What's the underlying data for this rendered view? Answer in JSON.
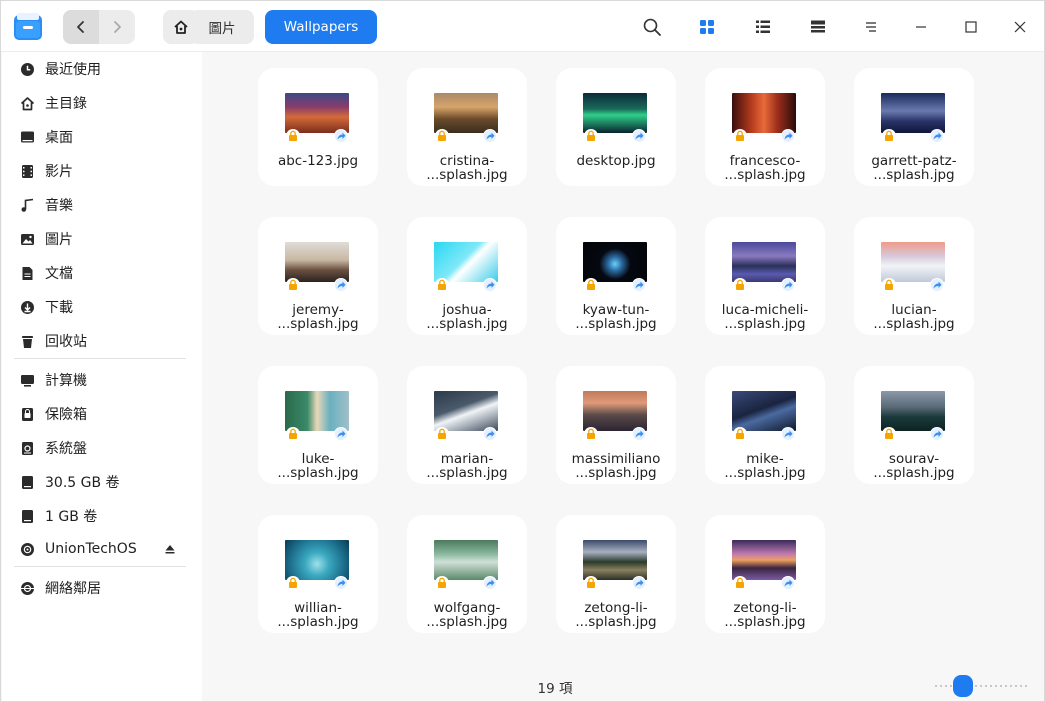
{
  "breadcrumb": {
    "parent": "圖片",
    "current": "Wallpapers"
  },
  "sidebar": {
    "items": [
      {
        "label": "最近使用",
        "icon": "clock-icon"
      },
      {
        "label": "主目錄",
        "icon": "home-icon"
      },
      {
        "label": "桌面",
        "icon": "desktop-icon"
      },
      {
        "label": "影片",
        "icon": "film-icon"
      },
      {
        "label": "音樂",
        "icon": "music-icon"
      },
      {
        "label": "圖片",
        "icon": "picture-icon"
      },
      {
        "label": "文檔",
        "icon": "document-icon"
      },
      {
        "label": "下載",
        "icon": "download-icon"
      },
      {
        "label": "回收站",
        "icon": "trash-icon"
      },
      {
        "label": "計算機",
        "icon": "computer-icon"
      },
      {
        "label": "保險箱",
        "icon": "vault-icon"
      },
      {
        "label": "系統盤",
        "icon": "system-disk-icon"
      },
      {
        "label": "30.5 GB 卷",
        "icon": "disk-icon"
      },
      {
        "label": "1 GB 卷",
        "icon": "disk-icon"
      },
      {
        "label": "UnionTechOS",
        "icon": "disc-icon"
      },
      {
        "label": "網絡鄰居",
        "icon": "network-icon"
      }
    ]
  },
  "files": [
    {
      "line1": "abc-123.jpg",
      "line2": ""
    },
    {
      "line1": "cristina-",
      "line2": "...splash.jpg"
    },
    {
      "line1": "desktop.jpg",
      "line2": ""
    },
    {
      "line1": "francesco-",
      "line2": "...splash.jpg"
    },
    {
      "line1": "garrett-patz-",
      "line2": "...splash.jpg"
    },
    {
      "line1": "jeremy-",
      "line2": "...splash.jpg"
    },
    {
      "line1": "joshua-",
      "line2": "...splash.jpg"
    },
    {
      "line1": "kyaw-tun-",
      "line2": "...splash.jpg"
    },
    {
      "line1": "luca-micheli-",
      "line2": "...splash.jpg"
    },
    {
      "line1": "lucian-",
      "line2": "...splash.jpg"
    },
    {
      "line1": "luke-",
      "line2": "...splash.jpg"
    },
    {
      "line1": "marian-",
      "line2": "...splash.jpg"
    },
    {
      "line1": "massimiliano",
      "line2": "...splash.jpg"
    },
    {
      "line1": "mike-",
      "line2": "...splash.jpg"
    },
    {
      "line1": "sourav-",
      "line2": "...splash.jpg"
    },
    {
      "line1": "willian-",
      "line2": "...splash.jpg"
    },
    {
      "line1": "wolfgang-",
      "line2": "...splash.jpg"
    },
    {
      "line1": "zetong-li-",
      "line2": "...splash.jpg"
    },
    {
      "line1": "zetong-li-",
      "line2": "...splash.jpg"
    }
  ],
  "status": {
    "count": "19 項"
  },
  "zoom": {
    "level": 0.25
  },
  "colors": {
    "accent": "#1f7cf0",
    "lock": "#f5a500",
    "share": "#3b8ff0"
  }
}
